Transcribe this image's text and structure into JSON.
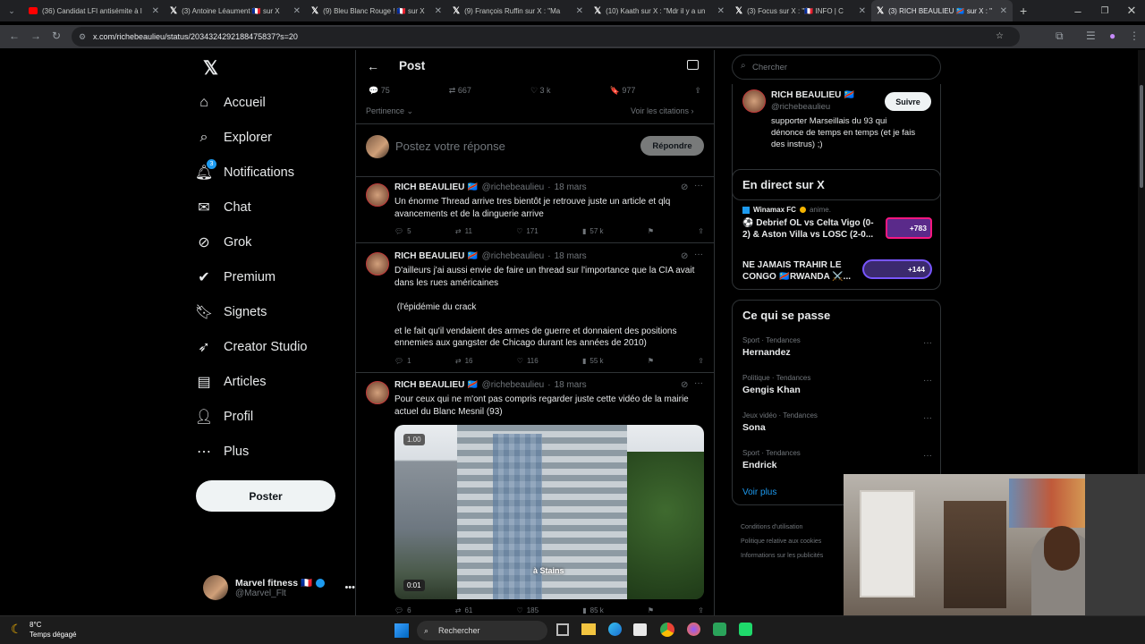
{
  "browser": {
    "tabs": [
      {
        "label": "(36) Candidat LFI antisémite à l",
        "icon": "youtube-icon"
      },
      {
        "label": "(3) Antoine Léaument 🇫🇷 sur X",
        "icon": "x-icon"
      },
      {
        "label": "(9) Bleu Blanc Rouge ! 🇫🇷 sur X",
        "icon": "x-icon"
      },
      {
        "label": "(9) François Ruffin sur X : \"Ma",
        "icon": "x-icon"
      },
      {
        "label": "(10) Kaath sur X : \"Mdr il y a un",
        "icon": "x-icon"
      },
      {
        "label": "(3) Focus sur X : \"🇫🇷 INFO | C",
        "icon": "x-icon"
      },
      {
        "label": "(3) RICH BEAULIEU 🇨🇩 sur X : \"",
        "icon": "x-icon"
      }
    ],
    "url": "x.com/richebeaulieu/status/2034324292188475837?s=20"
  },
  "sidebar": {
    "items": [
      {
        "label": "Accueil",
        "icon": "home-icon"
      },
      {
        "label": "Explorer",
        "icon": "search-icon"
      },
      {
        "label": "Notifications",
        "icon": "bell-icon",
        "badge": "3"
      },
      {
        "label": "Chat",
        "icon": "mail-icon"
      },
      {
        "label": "Grok",
        "icon": "grok-icon"
      },
      {
        "label": "Premium",
        "icon": "verified-icon"
      },
      {
        "label": "Signets",
        "icon": "bookmark-icon"
      },
      {
        "label": "Creator Studio",
        "icon": "rocket-icon"
      },
      {
        "label": "Articles",
        "icon": "article-icon"
      },
      {
        "label": "Profil",
        "icon": "person-icon"
      },
      {
        "label": "Plus",
        "icon": "more-circle-icon"
      }
    ],
    "post_button": "Poster",
    "account": {
      "name": "Marvel fitness 🇫🇷",
      "handle": "@Marvel_Flt"
    }
  },
  "main": {
    "title": "Post",
    "stats": {
      "replies": "75",
      "reposts": "667",
      "likes": "3 k",
      "bookmarks": "977"
    },
    "sort_label": "Pertinence",
    "quotes_link": "Voir les citations",
    "reply_placeholder": "Postez votre réponse",
    "reply_button": "Répondre",
    "tweets": [
      {
        "name": "RICH BEAULIEU 🇨🇩",
        "handle": "@richebeaulieu",
        "date": "18 mars",
        "lines": [
          "Un énorme Thread arrive tres bientôt je retrouve juste un article et qlq",
          "avancements et de la dinguerie arrive"
        ],
        "replies": "5",
        "reposts": "11",
        "likes": "171",
        "views": "57 k"
      },
      {
        "name": "RICH BEAULIEU 🇨🇩",
        "handle": "@richebeaulieu",
        "date": "18 mars",
        "lines": [
          "D'ailleurs j'ai aussi envie de faire un thread sur l'importance que la CIA avait",
          "dans les rues américaines",
          "",
          " (l'épidémie du crack",
          "",
          "et le fait qu'il vendaient des armes de guerre et donnaient des positions",
          "ennemies aux gangster de Chicago durant les années de 2010)"
        ],
        "replies": "1",
        "reposts": "16",
        "likes": "116",
        "views": "55 k"
      },
      {
        "name": "RICH BEAULIEU 🇨🇩",
        "handle": "@richebeaulieu",
        "date": "18 mars",
        "lines": [
          "Pour ceux qui ne m'ont pas compris regarder juste cette vidéo de la mairie",
          "actuel du Blanc Mesnil (93)"
        ],
        "video": {
          "speed": "1.00",
          "time": "0:01",
          "caption": "à Stains"
        },
        "replies": "6",
        "reposts": "61",
        "likes": "185",
        "views": "85 k"
      }
    ]
  },
  "right": {
    "search_placeholder": "Chercher",
    "profile": {
      "name": "RICH BEAULIEU 🇨🇩",
      "handle": "@richebeaulieu",
      "follow": "Suivre",
      "bio": [
        "supporter Marseillais du 93 qui",
        "dénonce de temps en temps (et je fais",
        "des instrus) ;)"
      ]
    },
    "live": {
      "title": "En direct sur X",
      "items": [
        {
          "host": "Winamax FC",
          "extra": "anime.",
          "line1": "⚽ Debrief OL vs Celta Vigo (0-",
          "line2": "2) & Aston Villa vs LOSC (2-0...",
          "count": "+783"
        },
        {
          "line1": "NE JAMAIS TRAHIR LE",
          "line2": "CONGO 🇨🇩RWANDA ⚔️...",
          "count": "+144"
        }
      ]
    },
    "trends": {
      "title": "Ce qui se passe",
      "items": [
        {
          "category": "Sport · Tendances",
          "name": "Hernandez"
        },
        {
          "category": "Politique · Tendances",
          "name": "Gengis Khan"
        },
        {
          "category": "Jeux vidéo · Tendances",
          "name": "Sona"
        },
        {
          "category": "Sport · Tendances",
          "name": "Endrick"
        }
      ],
      "more": "Voir plus"
    },
    "footer": [
      "Conditions d'utilisation",
      "Politique relative aux cookies",
      "Informations sur les publicités"
    ]
  },
  "taskbar": {
    "weather_temp": "8°C",
    "weather_desc": "Temps dégagé",
    "search": "Rechercher"
  },
  "colors": {
    "accent": "#1d9bf0",
    "bg": "#000000",
    "border": "#2f3336",
    "muted": "#71767b"
  }
}
